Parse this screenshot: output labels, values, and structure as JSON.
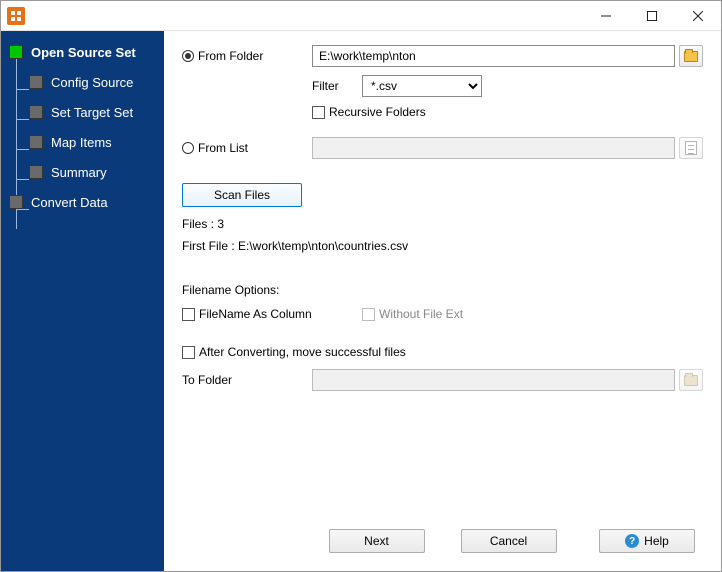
{
  "titlebar": {
    "title": ""
  },
  "sidebar": {
    "items": [
      {
        "label": "Open Source Set",
        "active": true
      },
      {
        "label": "Config Source"
      },
      {
        "label": "Set Target Set"
      },
      {
        "label": "Map Items"
      },
      {
        "label": "Summary"
      },
      {
        "label": "Convert Data"
      }
    ]
  },
  "main": {
    "from_folder_label": "From Folder",
    "from_folder_value": "E:\\work\\temp\\nton",
    "filter_label": "Filter",
    "filter_value": "*.csv",
    "recursive_label": "Recursive Folders",
    "from_list_label": "From List",
    "from_list_value": "",
    "scan_button": "Scan Files",
    "files_count_label": "Files : 3",
    "first_file_label": "First File : E:\\work\\temp\\nton\\countries.csv",
    "filename_options_label": "Filename Options:",
    "filename_as_column_label": "FileName As Column",
    "without_ext_label": "Without File Ext",
    "after_convert_label": "After Converting, move successful files",
    "to_folder_label": "To Folder",
    "to_folder_value": ""
  },
  "footer": {
    "next": "Next",
    "cancel": "Cancel",
    "help": "Help"
  }
}
